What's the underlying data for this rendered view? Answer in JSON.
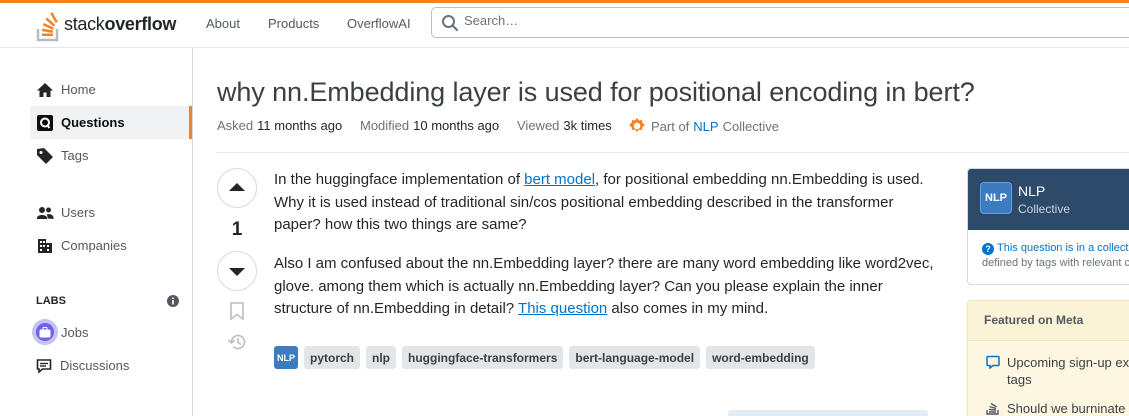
{
  "header": {
    "logo_regular": "stack",
    "logo_bold": "overflow",
    "nav": [
      "About",
      "Products",
      "OverflowAI"
    ],
    "search_placeholder": "Search…",
    "accent": "#f48225"
  },
  "sidebar": {
    "items": [
      {
        "label": "Home",
        "icon": "home-icon"
      },
      {
        "label": "Questions",
        "icon": "questions-icon",
        "active": true
      },
      {
        "label": "Tags",
        "icon": "tag-icon"
      },
      {
        "label": "Users",
        "icon": "users-icon"
      },
      {
        "label": "Companies",
        "icon": "companies-icon"
      }
    ],
    "labs_label": "LABS",
    "labs_items": [
      {
        "label": "Jobs",
        "icon": "briefcase-icon"
      },
      {
        "label": "Discussions",
        "icon": "discussions-icon"
      }
    ]
  },
  "question": {
    "title": "why nn.Embedding layer is used for positional encoding in bert?",
    "asked_label": "Asked",
    "asked_value": "11 months ago",
    "modified_label": "Modified",
    "modified_value": "10 months ago",
    "viewed_label": "Viewed",
    "viewed_value": "3k times",
    "collective_prefix": "Part of",
    "collective_name": "NLP",
    "collective_suffix": "Collective",
    "votes": "1",
    "p1_before": "In the huggingface implementation of ",
    "p1_link": "bert model",
    "p1_after": ", for positional embedding nn.Embedding is used. Why it is used instead of traditional sin/cos positional embedding described in the transformer paper? how this two things are same?",
    "p2_before": "Also I am confused about the nn.Embedding layer? there are many word embedding like word2vec, glove. among them which is actually nn.Embedding layer? Can you please explain the inner structure of nn.Embedding in detail? ",
    "p2_link": "This question",
    "p2_after": " also comes in my mind.",
    "collective_tag": "NLP",
    "tags": [
      "pytorch",
      "nlp",
      "huggingface-transformers",
      "bert-language-model",
      "word-embedding"
    ]
  },
  "right": {
    "collective_logo": "NLP",
    "collective_name": "NLP",
    "collective_sub": "Collective",
    "collective_note_link": "This question is in a collect",
    "collective_note_rest": "defined by tags with relevant c",
    "featured_title": "Featured on Meta",
    "featured_items": [
      {
        "line1": "Upcoming sign-up ex",
        "line2": "tags",
        "icon": "chat-icon"
      },
      {
        "line1": "Should we burninate",
        "line2": "",
        "icon": "stack-icon"
      }
    ]
  }
}
